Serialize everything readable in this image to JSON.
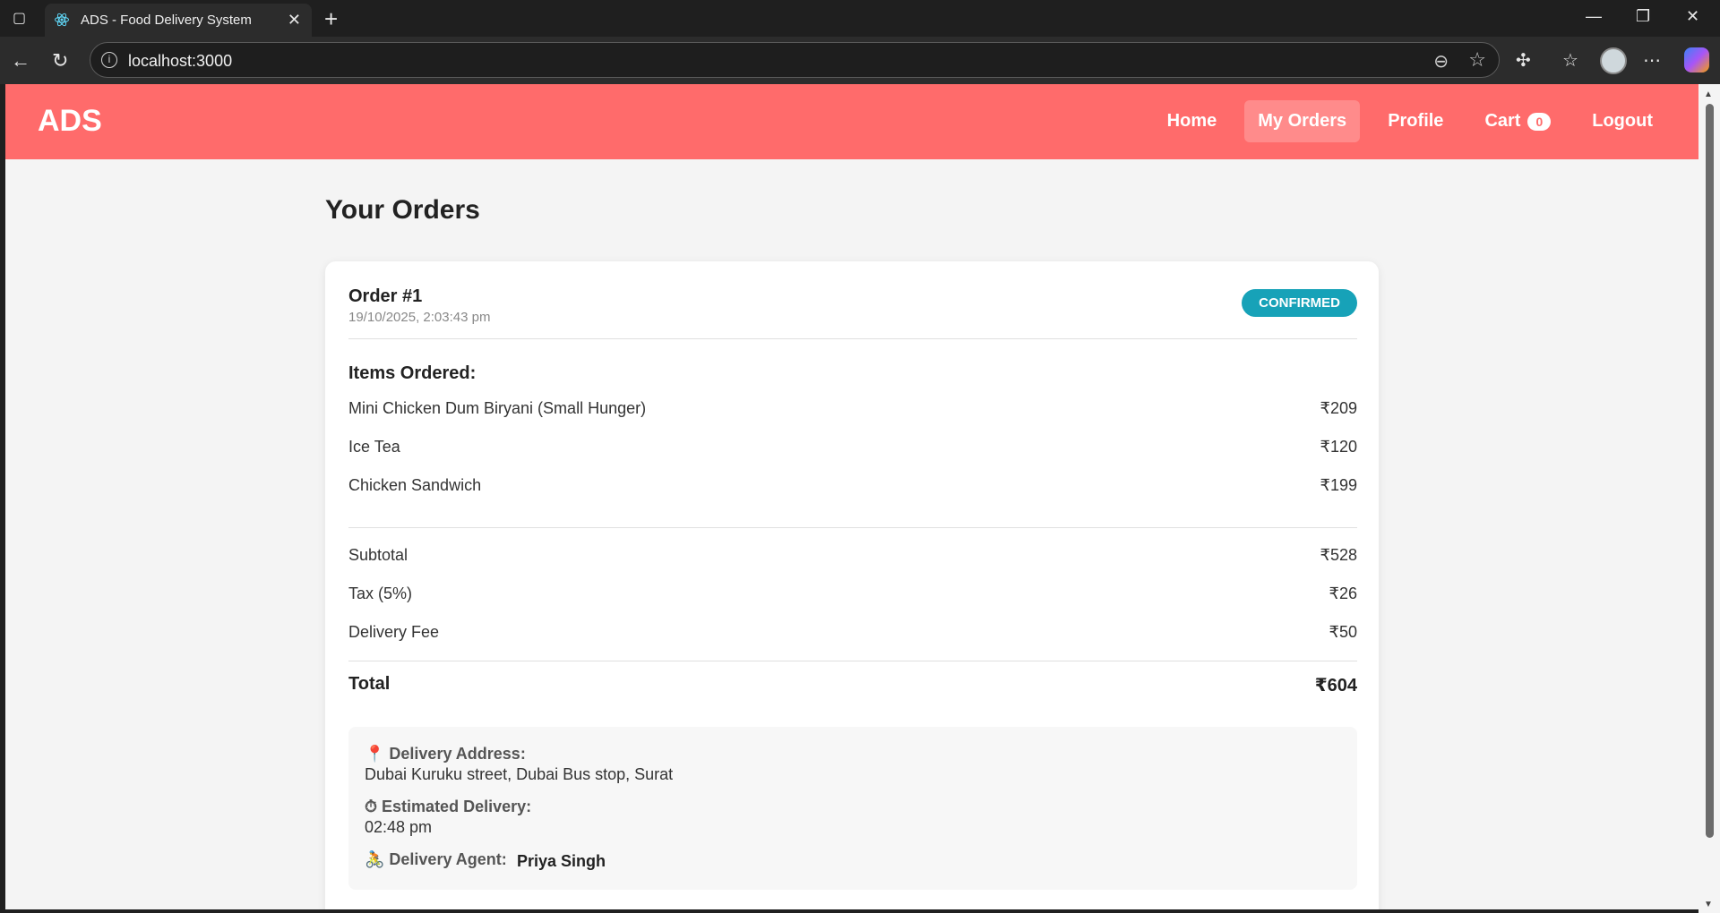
{
  "browser": {
    "tab_title": "ADS - Food Delivery System",
    "url": "localhost:3000",
    "icons": [
      "sidebar-icon",
      "react-icon",
      "close-icon",
      "plus-icon",
      "back-icon",
      "refresh-icon",
      "info-icon",
      "reader-icon",
      "star-icon",
      "extensions-icon",
      "favorites-icon",
      "more-icon"
    ]
  },
  "header": {
    "brand": "ADS",
    "nav": {
      "home": "Home",
      "orders": "My Orders",
      "profile": "Profile",
      "cart": "Cart",
      "cart_count": "0",
      "logout": "Logout"
    },
    "accent_color": "#ff6b6b"
  },
  "page": {
    "title": "Your Orders"
  },
  "order": {
    "title": "Order #1",
    "date": "19/10/2025, 2:03:43 pm",
    "status": "CONFIRMED",
    "status_color": "#17a2b8",
    "items_heading": "Items Ordered:",
    "items": [
      {
        "name": "Mini Chicken Dum Biryani (Small Hunger)",
        "price": "₹209"
      },
      {
        "name": "Ice Tea",
        "price": "₹120"
      },
      {
        "name": "Chicken Sandwich",
        "price": "₹199"
      }
    ],
    "subtotal": {
      "label": "Subtotal",
      "value": "₹528"
    },
    "tax": {
      "label": "Tax (5%)",
      "value": "₹26"
    },
    "delivery_fee": {
      "label": "Delivery Fee",
      "value": "₹50"
    },
    "total": {
      "label": "Total",
      "value": "₹604"
    },
    "delivery": {
      "address_label": "📍 Delivery Address:",
      "address": "Dubai Kuruku street, Dubai Bus stop, Surat",
      "eta_label": "⏱ Estimated Delivery:",
      "eta": "02:48 pm",
      "agent_label": "🚴 Delivery Agent:",
      "agent": "Priya Singh"
    }
  }
}
